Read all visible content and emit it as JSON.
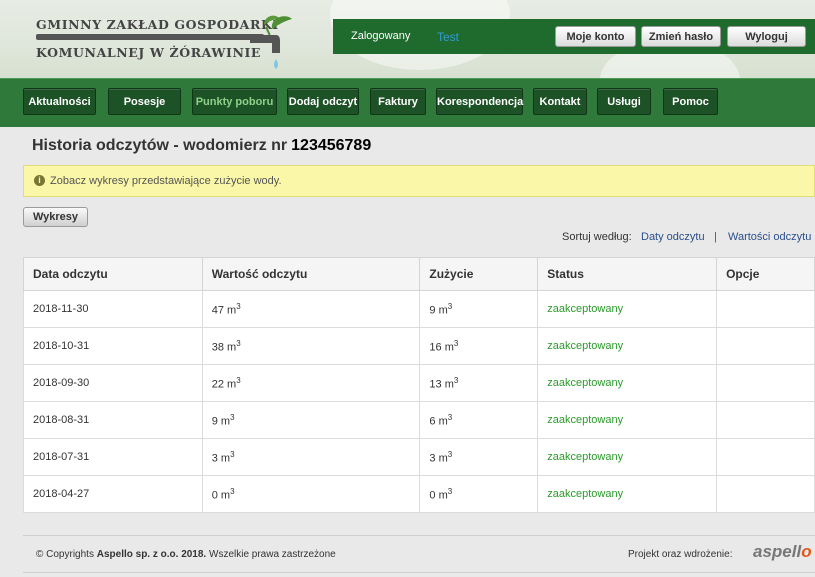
{
  "header": {
    "logo_line1": "GMINNY ZAKŁAD GOSPODARKI",
    "logo_line2": "KOMUNALNEJ W ŻÓRAWINIE",
    "logged_label": "Zalogowany",
    "user_name": "Test",
    "buttons": [
      "Moje konto",
      "Zmień hasło",
      "Wyloguj"
    ]
  },
  "nav": {
    "items": [
      "Aktualności",
      "Posesje",
      "Punkty poboru",
      "Dodaj odczyt",
      "Faktury",
      "Korespondencja",
      "Kontakt",
      "Usługi",
      "Pomoc"
    ],
    "active": "Punkty poboru"
  },
  "main": {
    "title": "Historia odczytów - wodomierz nr",
    "meter_number": "123456789",
    "info_text": "Zobacz wykresy przedstawiające zużycie wody.",
    "charts_button": "Wykresy",
    "sort_label": "Sortuj według:",
    "sort_options": [
      "Daty odczytu",
      "Wartości odczytu"
    ],
    "sort_separator": "|"
  },
  "table": {
    "headers": [
      "Data odczytu",
      "Wartość odczytu",
      "Zużycie",
      "Status",
      "Opcje"
    ],
    "unit": "m",
    "unit_exp": "3",
    "rows": [
      {
        "date": "2018-11-30",
        "value": "47",
        "usage": "9",
        "status": "zaakceptowany"
      },
      {
        "date": "2018-10-31",
        "value": "38",
        "usage": "16",
        "status": "zaakceptowany"
      },
      {
        "date": "2018-09-30",
        "value": "22",
        "usage": "13",
        "status": "zaakceptowany"
      },
      {
        "date": "2018-08-31",
        "value": "9",
        "usage": "6",
        "status": "zaakceptowany"
      },
      {
        "date": "2018-07-31",
        "value": "3",
        "usage": "3",
        "status": "zaakceptowany"
      },
      {
        "date": "2018-04-27",
        "value": "0",
        "usage": "0",
        "status": "zaakceptowany"
      }
    ]
  },
  "footer": {
    "copy_prefix": "© Copyrights",
    "copy_company": "Aspello sp. z o.o. 2018.",
    "copy_suffix": "Wszelkie prawa zastrzeżone",
    "project_label": "Projekt oraz wdrożenie:",
    "brand_a": "aspell",
    "brand_b": "o"
  },
  "colors": {
    "header_bar": "#1f6b2e",
    "nav_bar": "#2f7a3a",
    "active_nav": "#8fd08a",
    "status_ok": "#2b9a2b",
    "info_bg": "#faf7a8"
  }
}
